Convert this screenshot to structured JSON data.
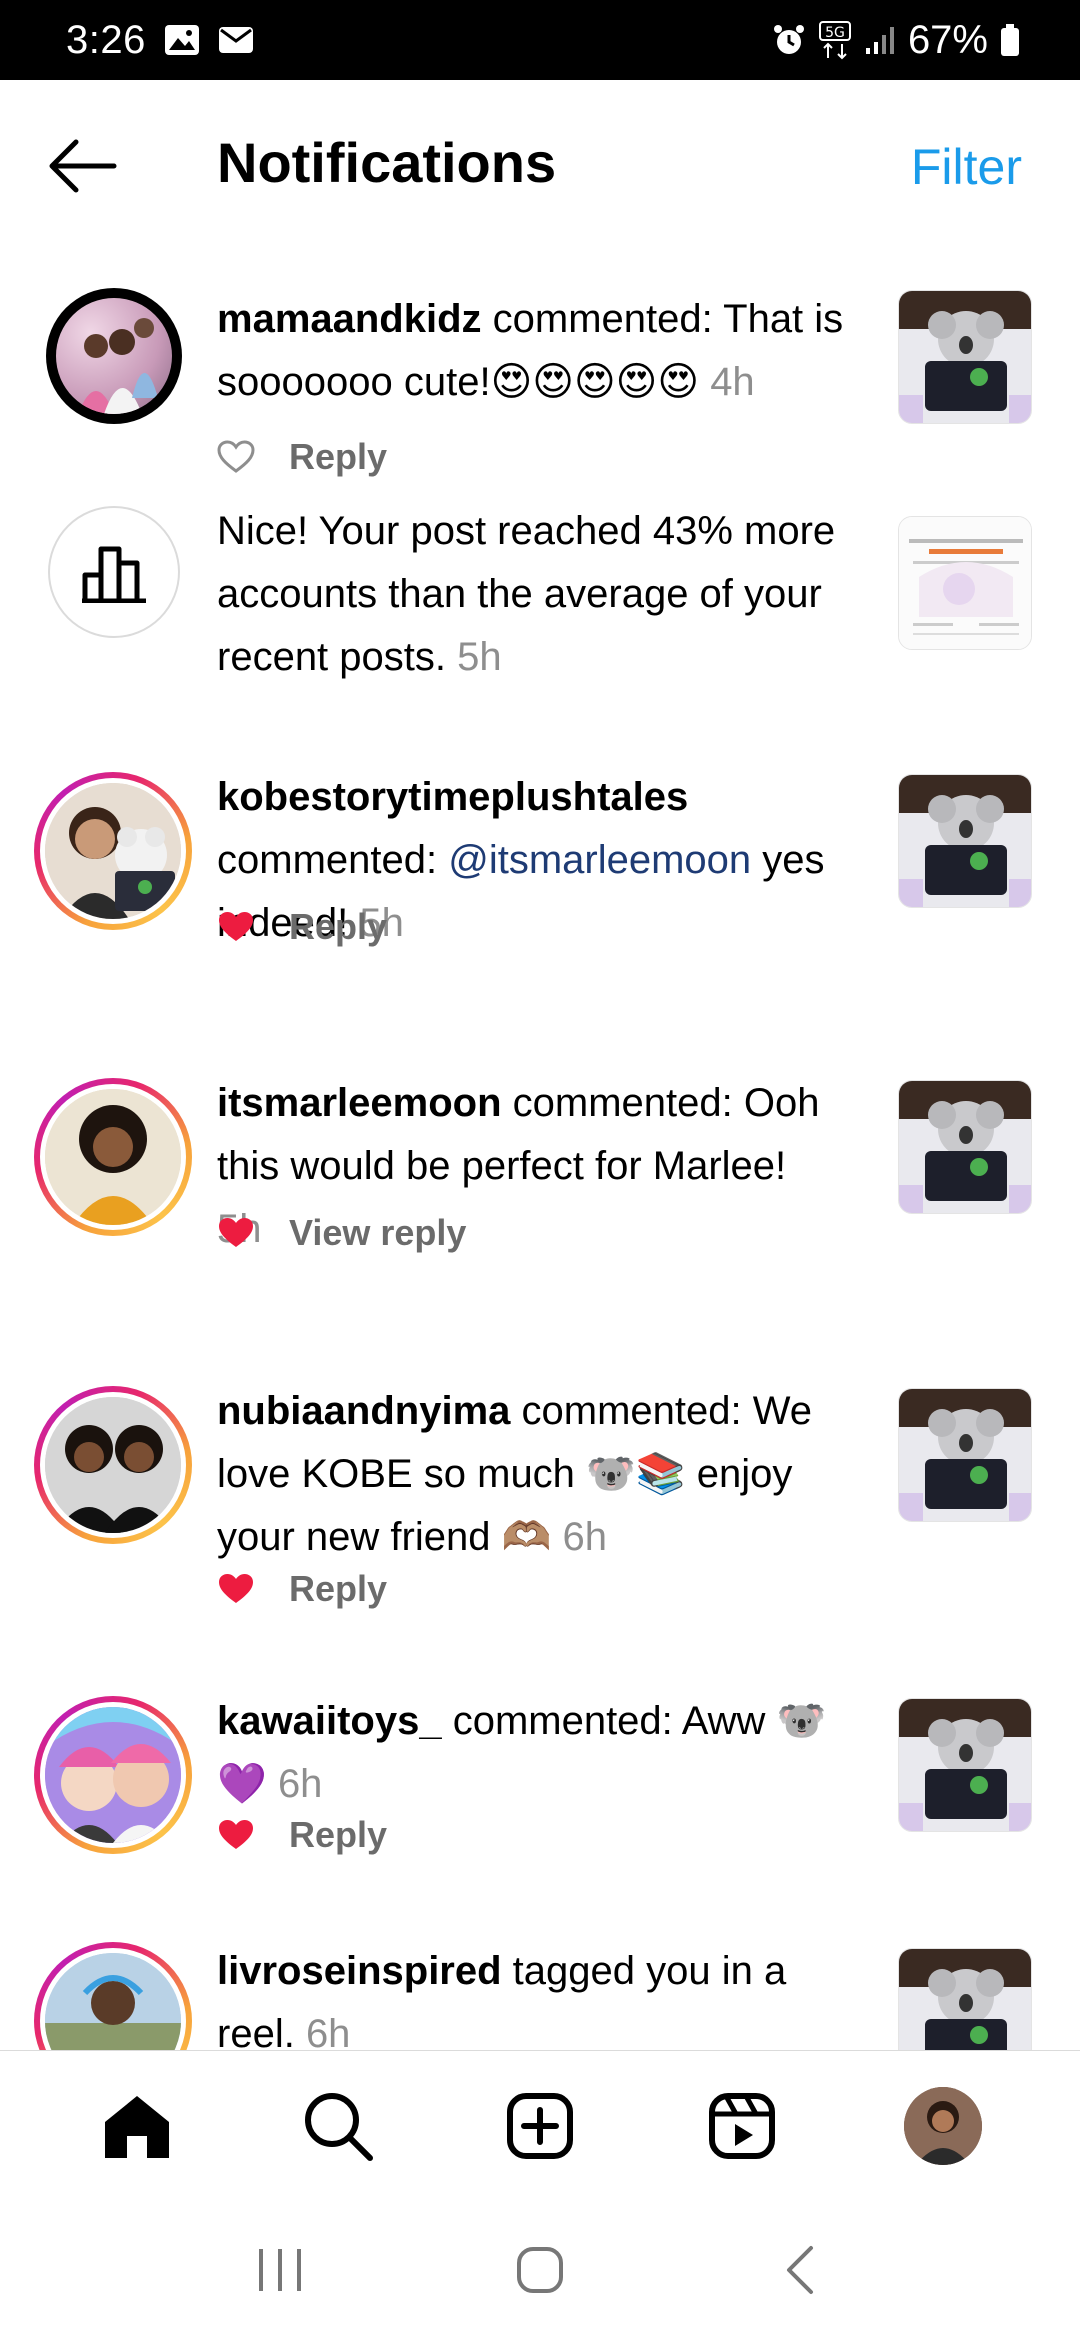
{
  "status_bar": {
    "time": "3:26",
    "battery": "67%",
    "left_icons": [
      "image-icon",
      "mail-icon"
    ],
    "right_icons": [
      "alarm-icon",
      "5g-icon",
      "signal-icon",
      "battery-icon"
    ]
  },
  "header": {
    "title": "Notifications",
    "filter_label": "Filter"
  },
  "notifications": [
    {
      "username": "mamaandkidz",
      "text": " commented: That is sooooooo cute!",
      "emoji": "😍😍😍😍😍",
      "time": "4h",
      "action": "Reply",
      "liked": false
    },
    {
      "text": "Nice! Your post reached 43% more accounts than the average of your recent posts.",
      "time": "5h"
    },
    {
      "username": "kobestorytimeplushtales",
      "text_before": "commented: ",
      "mention": "@itsmarleemoon",
      "text_after": " yes indeed!",
      "time": "5h",
      "action": "Reply",
      "liked": true
    },
    {
      "username": "itsmarleemoon",
      "text": " commented: Ooh this would be perfect for Marlee!",
      "time": "5h",
      "action": "View reply",
      "liked": true
    },
    {
      "username": "nubiaandnyima",
      "text": " commented: We love KOBE so much ",
      "emoji1": "🐨📚",
      "text2": " enjoy your new friend ",
      "emoji2": "🫶🏽",
      "time": "6h",
      "action": "Reply",
      "liked": true
    },
    {
      "username": "kawaiitoys_",
      "text": " commented: Aww ",
      "emoji": "🐨💜",
      "time": "6h",
      "action": "Reply",
      "liked": true
    },
    {
      "username": "livroseinspired",
      "text": " tagged you in a reel.",
      "time": "6h"
    }
  ],
  "colors": {
    "accent": "#1a9bea",
    "heart": "#ed1c40",
    "mention": "#1e3b74",
    "muted": "#8e8e8e"
  },
  "bottom_nav": [
    "home-icon",
    "search-icon",
    "create-icon",
    "reels-icon",
    "profile-avatar"
  ],
  "system_nav": [
    "recents-icon",
    "home-circle-icon",
    "back-chevron-icon"
  ]
}
